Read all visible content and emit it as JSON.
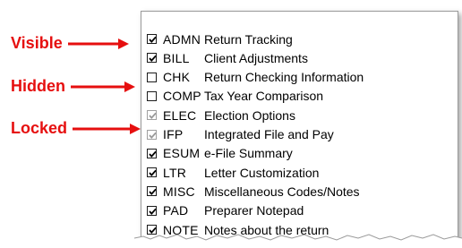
{
  "annotations": [
    {
      "label": "Visible",
      "color": "#e60f0f"
    },
    {
      "label": "Hidden",
      "color": "#e60f0f"
    },
    {
      "label": "Locked",
      "color": "#e60f0f"
    }
  ],
  "items": [
    {
      "code": "ADMN",
      "desc": "Return Tracking",
      "checked": true,
      "locked": false
    },
    {
      "code": "BILL",
      "desc": "Client Adjustments",
      "checked": true,
      "locked": false
    },
    {
      "code": "CHK",
      "desc": "Return Checking Information",
      "checked": false,
      "locked": false
    },
    {
      "code": "COMP",
      "desc": "Tax Year Comparison",
      "checked": false,
      "locked": false
    },
    {
      "code": "ELEC",
      "desc": "Election Options",
      "checked": true,
      "locked": true
    },
    {
      "code": "IFP",
      "desc": "Integrated File and Pay",
      "checked": true,
      "locked": true
    },
    {
      "code": "ESUM",
      "desc": "e-File Summary",
      "checked": true,
      "locked": false
    },
    {
      "code": "LTR",
      "desc": "Letter Customization",
      "checked": true,
      "locked": false
    },
    {
      "code": "MISC",
      "desc": "Miscellaneous Codes/Notes",
      "checked": true,
      "locked": false
    },
    {
      "code": "PAD",
      "desc": "Preparer Notepad",
      "checked": true,
      "locked": false
    },
    {
      "code": "NOTE",
      "desc": "Notes about the return",
      "checked": true,
      "locked": false
    }
  ]
}
